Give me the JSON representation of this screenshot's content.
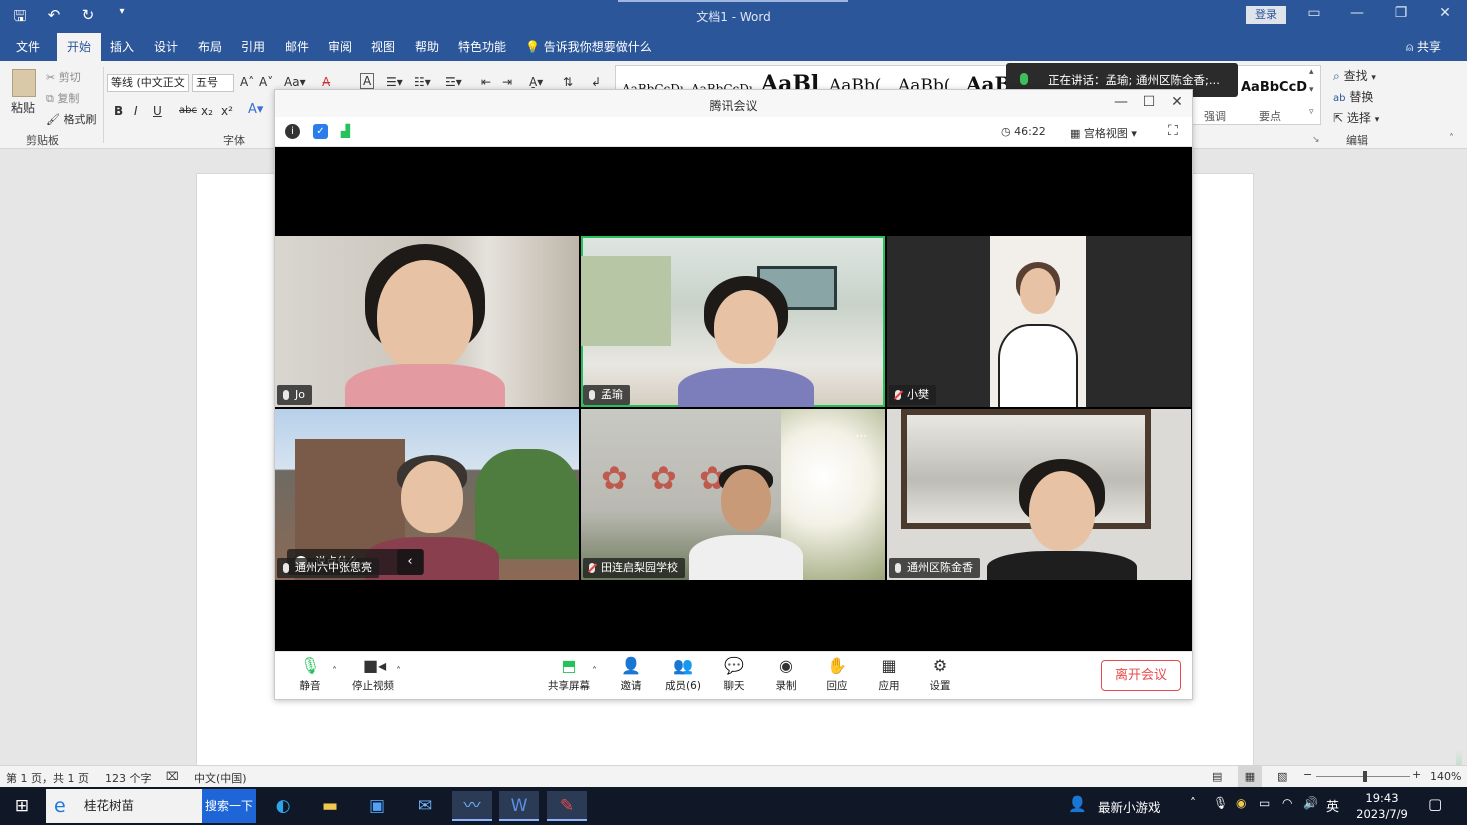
{
  "word": {
    "title": "文档1  -  Word",
    "login": "登录",
    "tabs": [
      "文件",
      "开始",
      "插入",
      "设计",
      "布局",
      "引用",
      "邮件",
      "审阅",
      "视图",
      "帮助",
      "特色功能"
    ],
    "tell_me": "告诉我你想要做什么",
    "share": "共享",
    "clipboard": {
      "paste": "粘贴",
      "cut": "剪切",
      "copy": "复制",
      "format_painter": "格式刷",
      "group": "剪贴板"
    },
    "font": {
      "name": "等线 (中文正文",
      "size": "五号",
      "group": "字体",
      "bold": "B",
      "italic": "I",
      "underline": "U",
      "strike": "abc",
      "sub": "x₂",
      "sup": "x²"
    },
    "styles": {
      "samples": [
        "AaBbCcDı",
        "AaBbCcDı",
        "AaBl",
        "AaBb(",
        "AaBb(",
        "AaBl",
        "AaBbCcD"
      ],
      "cap_a": "强调",
      "cap_b": "要点"
    },
    "editing": {
      "find": "查找",
      "replace": "替换",
      "select": "选择",
      "group": "编辑"
    },
    "status": {
      "page": "第 1 页，共 1 页",
      "words": "123 个字",
      "lang": "中文(中国)",
      "zoom": "140%"
    },
    "zoom_level": 0.52
  },
  "speaking": {
    "text": "正在讲话：孟瑜; 通州区陈金香;..."
  },
  "meeting": {
    "title": "腾讯会议",
    "timer": "46:22",
    "view": "宫格视图",
    "participants": [
      {
        "name": "Jo",
        "muted": false
      },
      {
        "name": "孟瑜",
        "muted": false,
        "active": true
      },
      {
        "name": "小樊",
        "muted": true
      },
      {
        "name": "通州六中张思亮",
        "muted": false
      },
      {
        "name": "田连启梨园学校",
        "muted": true
      },
      {
        "name": "通州区陈金香",
        "muted": false
      }
    ],
    "say_something": "说点什么...",
    "toolbar": {
      "mute": "静音",
      "stop_video": "停止视频",
      "share_screen": "共享屏幕",
      "invite": "邀请",
      "members": "成员(6)",
      "chat": "聊天",
      "record": "录制",
      "react": "回应",
      "apps": "应用",
      "settings": "设置",
      "leave": "离开会议"
    }
  },
  "taskbar": {
    "search_text": "桂花树苗",
    "search_btn": "搜索一下",
    "game": "最新小游戏",
    "ime": "英",
    "time": "19:43",
    "date": "2023/7/9"
  }
}
